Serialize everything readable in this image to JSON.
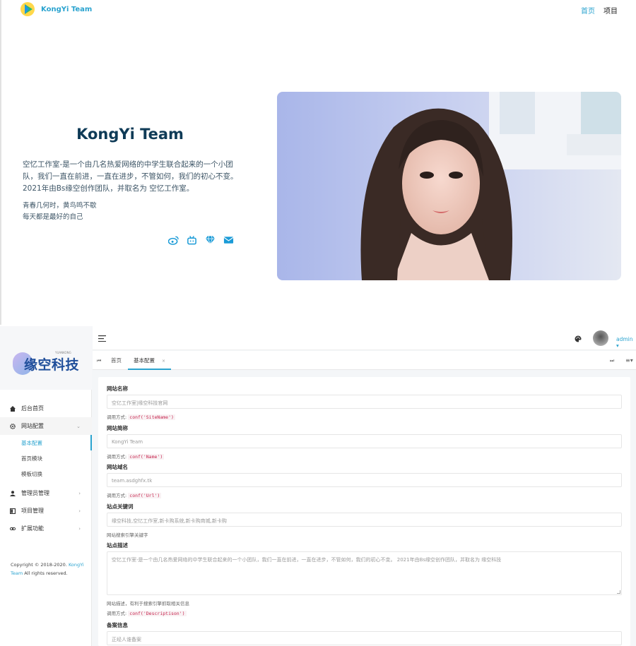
{
  "site": {
    "brand": "KongYi Team",
    "nav": {
      "home": "首页",
      "projects": "项目"
    },
    "hero": {
      "title": "KongYi Team",
      "description": "空忆工作室-是一个由几名热爱网络的中学生联合起来的一个小团队，我们一直在前进，一直在进步，不管如何，我们的初心不变。2021年由Bs缘空创作团队，并取名为 空忆工作室。",
      "motto_line1": "青春几何时，黄鸟鸣不歇",
      "motto_line2": "每天都是最好的自己"
    },
    "socials": [
      "weibo-icon",
      "bilibili-icon",
      "diamond-icon",
      "mail-icon"
    ]
  },
  "admin": {
    "sidebar": {
      "logo_text": "缘空科技",
      "logo_sub": "YUANKONG",
      "menu": {
        "dashboard": "后台首页",
        "site_config": "网站配置",
        "basic_config": "基本配置",
        "home_module": "首页模块",
        "template_switch": "模板切换",
        "admin_manage": "管理员管理",
        "project_manage": "项目管理",
        "extensions": "扩展功能"
      },
      "copyright_prefix": "Copyright © 2018-2020.",
      "copyright_link": "KongYi Team",
      "copyright_suffix": "All rights reserved."
    },
    "topbar": {
      "user": "admin ▾"
    },
    "tabs": {
      "home": "首页",
      "current": "基本配置",
      "close": "×"
    },
    "form": {
      "site_name": {
        "label": "网站名称",
        "value": "空亿工作室|缘空科技官网",
        "hint": "调用方式:",
        "code": "conf('SiteName')"
      },
      "site_short": {
        "label": "网站简称",
        "value": "KongYi Team",
        "hint": "调用方式:",
        "code": "conf('Name')"
      },
      "site_domain": {
        "label": "网站域名",
        "value": "team.asdghfx.tk",
        "hint": "调用方式:",
        "code": "conf('Url')"
      },
      "keywords": {
        "label": "站点关键词",
        "value": "缘空科技,空忆工作室,新卡购系统,新卡购商城,新卡购",
        "hint": "网站搜索引擎关键字"
      },
      "description": {
        "label": "站点描述",
        "value": "空忆工作室-是一个由几名热爱网络的中学生联合起来的一个小团队，我们一直在前进，一直在进步，不管如何，我们的初心不变。 2021年由Bs缘空创作团队，并取名为 缘空科技",
        "hint": "网站描述，有利于搜索引擎抓取相关信息",
        "hint2": "调用方式:",
        "code": "conf('Descriptison')"
      },
      "icp": {
        "label": "备案信息",
        "value": "正经人谁备案"
      }
    }
  }
}
